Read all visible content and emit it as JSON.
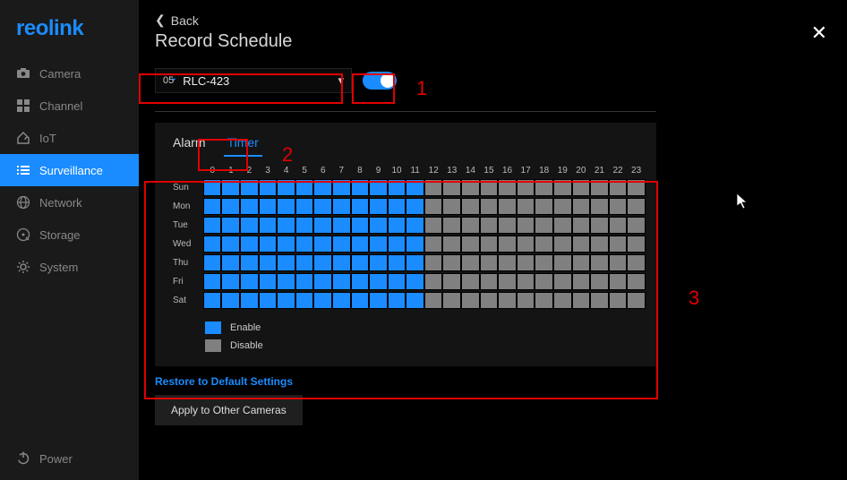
{
  "brand": "reolink",
  "sidebar": {
    "items": [
      {
        "label": "Camera",
        "icon": "camera-icon"
      },
      {
        "label": "Channel",
        "icon": "grid-icon"
      },
      {
        "label": "IoT",
        "icon": "home-icon"
      },
      {
        "label": "Surveillance",
        "icon": "list-icon",
        "active": true
      },
      {
        "label": "Network",
        "icon": "globe-icon"
      },
      {
        "label": "Storage",
        "icon": "disk-icon"
      },
      {
        "label": "System",
        "icon": "gear-icon"
      }
    ],
    "power": "Power"
  },
  "header": {
    "back": "Back",
    "title": "Record Schedule"
  },
  "camera": {
    "prefix": "05",
    "name": "RLC-423",
    "toggle_on": true
  },
  "tabs": [
    "Alarm",
    "Timer"
  ],
  "active_tab": "Timer",
  "schedule": {
    "hours": [
      "0",
      "1",
      "2",
      "3",
      "4",
      "5",
      "6",
      "7",
      "8",
      "9",
      "10",
      "11",
      "12",
      "13",
      "14",
      "15",
      "16",
      "17",
      "18",
      "19",
      "20",
      "21",
      "22",
      "23"
    ],
    "days": [
      "Sun",
      "Mon",
      "Tue",
      "Wed",
      "Thu",
      "Fri",
      "Sat"
    ],
    "enabled_until_hour": 11
  },
  "legend": {
    "enable": "Enable",
    "disable": "Disable"
  },
  "footer": {
    "restore": "Restore to Default Settings",
    "apply": "Apply to Other Cameras"
  },
  "annotations": {
    "a1": "1",
    "a2": "2",
    "a3": "3"
  },
  "colors": {
    "accent": "#1a8cff",
    "disabled_cell": "#808080",
    "annotation": "#e00000"
  }
}
